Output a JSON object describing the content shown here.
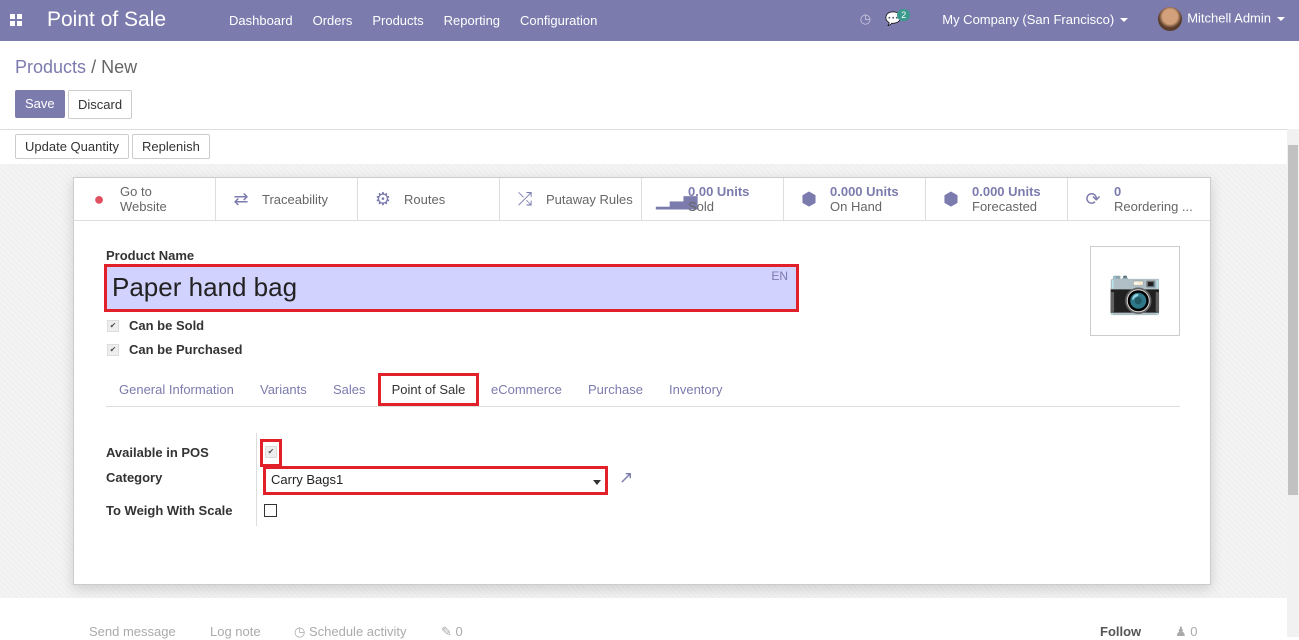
{
  "nav": {
    "app_title": "Point of Sale",
    "menu": [
      "Dashboard",
      "Orders",
      "Products",
      "Reporting",
      "Configuration"
    ],
    "messages_count": "2",
    "company": "My Company (San Francisco)",
    "user": "Mitchell Admin",
    "color": "#7c7bad"
  },
  "breadcrumb": {
    "parent": "Products",
    "sep": "/",
    "current": "New"
  },
  "actions": {
    "save": "Save",
    "discard": "Discard",
    "update_qty": "Update Quantity",
    "replenish": "Replenish"
  },
  "stats": [
    {
      "icon": "globe-icon",
      "top": "Go to",
      "bottom": "Website"
    },
    {
      "icon": "exchange-icon",
      "top": "",
      "bottom": "Traceability"
    },
    {
      "icon": "cogs-icon",
      "top": "",
      "bottom": "Routes"
    },
    {
      "icon": "random-icon",
      "top": "",
      "bottom": "Putaway Rules"
    },
    {
      "icon": "signal-icon",
      "top": "0.00 Units",
      "bottom": "Sold"
    },
    {
      "icon": "cubes-icon",
      "top": "0.000 Units",
      "bottom": "On Hand"
    },
    {
      "icon": "cubes-icon",
      "top": "0.000 Units",
      "bottom": "Forecasted"
    },
    {
      "icon": "refresh-icon",
      "top": "0",
      "bottom": "Reordering ..."
    }
  ],
  "form": {
    "name_label": "Product Name",
    "name": "Paper hand bag",
    "lang": "EN",
    "can_be_sold": "Can be Sold",
    "can_be_purchased": "Can be Purchased",
    "tabs": [
      "General Information",
      "Variants",
      "Sales",
      "Point of Sale",
      "eCommerce",
      "Purchase",
      "Inventory"
    ],
    "available_pos": "Available in POS",
    "category_label": "Category",
    "category": "Carry Bags1",
    "weigh_label": "To Weigh With Scale"
  },
  "chatter": {
    "send": "Send message",
    "log": "Log note",
    "schedule": "Schedule activity",
    "attachments": "0",
    "follow": "Follow",
    "followers": "0"
  }
}
